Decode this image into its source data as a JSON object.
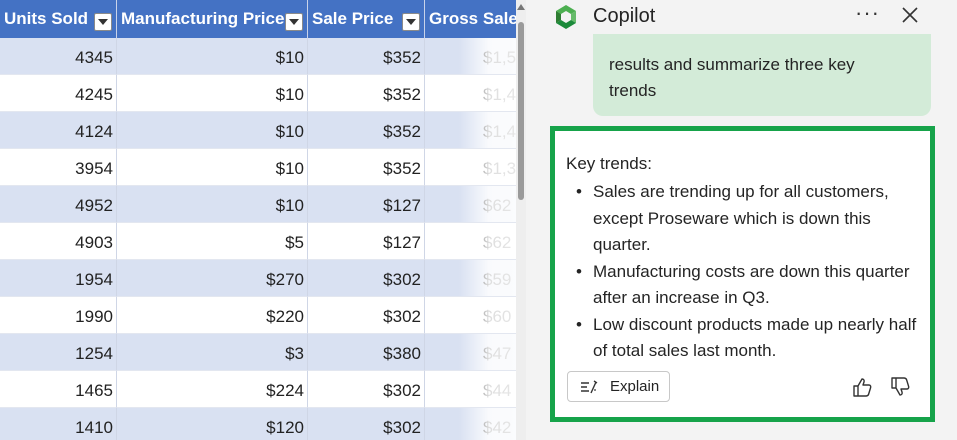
{
  "sheet": {
    "headers": [
      "Units Sold",
      "Manufacturing Price",
      "Sale Price",
      "Gross Sales"
    ],
    "rows": [
      [
        "4345",
        "$10",
        "$352",
        "$1,5"
      ],
      [
        "4245",
        "$10",
        "$352",
        "$1,4"
      ],
      [
        "4124",
        "$10",
        "$352",
        "$1,4"
      ],
      [
        "3954",
        "$10",
        "$352",
        "$1,3"
      ],
      [
        "4952",
        "$10",
        "$127",
        "$62"
      ],
      [
        "4903",
        "$5",
        "$127",
        "$62"
      ],
      [
        "1954",
        "$270",
        "$302",
        "$59"
      ],
      [
        "1990",
        "$220",
        "$302",
        "$60"
      ],
      [
        "1254",
        "$3",
        "$380",
        "$47"
      ],
      [
        "1465",
        "$224",
        "$302",
        "$44"
      ],
      [
        "1410",
        "$120",
        "$302",
        "$42"
      ]
    ],
    "colors": {
      "header_bg": "#4472c4",
      "band": "#d9e1f2"
    }
  },
  "copilot": {
    "title": "Copilot",
    "more_label": "···",
    "user_message_lines": [
      "results and summarize three key",
      "trends"
    ],
    "response": {
      "intro": "Key trends:",
      "bullets": [
        "Sales are trending up for all customers, except Proseware which is down this quarter.",
        "Manufacturing costs are down this quarter after an increase in Q3.",
        "Low discount products made up nearly half of total sales last month."
      ]
    },
    "explain_label": "Explain",
    "colors": {
      "accent": "#16a34a",
      "user_bubble": "#d3ebd8"
    },
    "icons": [
      "copilot-logo",
      "more-icon",
      "close-icon",
      "explain-icon",
      "thumbs-up-icon",
      "thumbs-down-icon"
    ]
  }
}
